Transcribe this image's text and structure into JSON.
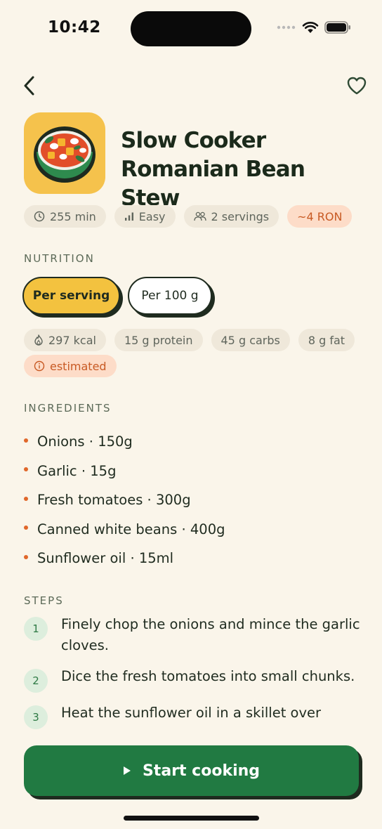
{
  "status_bar": {
    "time": "10:42"
  },
  "recipe": {
    "title_line1": "Slow Cooker",
    "title_line2": "Romanian Bean Stew"
  },
  "meta_chips": {
    "time": "255 min",
    "difficulty": "Easy",
    "servings": "2 servings",
    "price": "~4 RON"
  },
  "nutrition": {
    "label": "NUTRITION",
    "toggle_per_serving": "Per serving",
    "toggle_per_100g": "Per 100 g",
    "kcal": "297 kcal",
    "protein": "15 g protein",
    "carbs": "45 g carbs",
    "fat": "8 g fat",
    "estimated": "estimated"
  },
  "ingredients": {
    "label": "INGREDIENTS",
    "items": [
      {
        "name": "Onions",
        "qty": "150g"
      },
      {
        "name": "Garlic",
        "qty": "15g"
      },
      {
        "name": "Fresh tomatoes",
        "qty": "300g"
      },
      {
        "name": "Canned white beans",
        "qty": "400g"
      },
      {
        "name": "Sunflower oil",
        "qty": "15ml"
      }
    ]
  },
  "steps": {
    "label": "STEPS",
    "items": [
      {
        "num": "1",
        "text": "Finely chop the onions and mince the garlic cloves."
      },
      {
        "num": "2",
        "text": "Dice the fresh tomatoes into small chunks."
      },
      {
        "num": "3",
        "text": "Heat the sunflower oil in a skillet over"
      }
    ]
  },
  "cta": {
    "label": "Start cooking"
  },
  "colors": {
    "background": "#FAF5EA",
    "accent_yellow": "#F3C23F",
    "accent_green": "#217A42",
    "accent_orange": "#E0672A"
  },
  "icons": {
    "back": "chevron-left-icon",
    "favorite": "heart-outline-icon",
    "time": "clock-icon",
    "difficulty": "bar-chart-icon",
    "servings": "people-icon",
    "kcal": "flame-icon",
    "estimated": "info-icon",
    "cta": "play-icon"
  }
}
